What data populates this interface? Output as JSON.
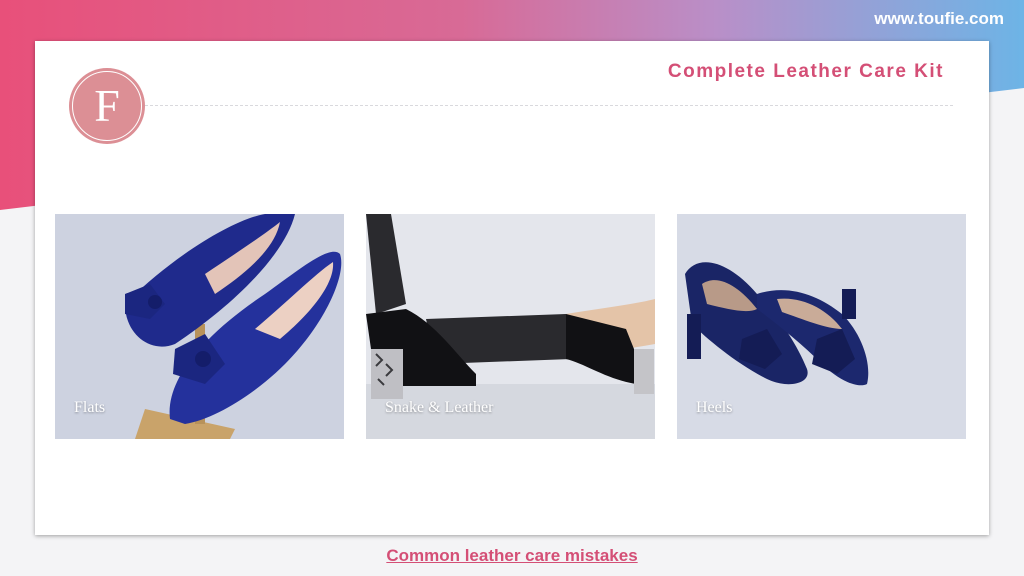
{
  "header": {
    "site_url": "www.toufie.com"
  },
  "card": {
    "logo_letter": "F",
    "title": "Complete Leather Care Kit"
  },
  "tiles": [
    {
      "label": "Flats"
    },
    {
      "label": "Snake & Leather"
    },
    {
      "label": "Heels"
    }
  ],
  "footer": {
    "link_text": "Common leather care mistakes"
  },
  "colors": {
    "accent": "#d44f76",
    "logo": "#dc8f95",
    "shoe": "#1f2f8a"
  }
}
